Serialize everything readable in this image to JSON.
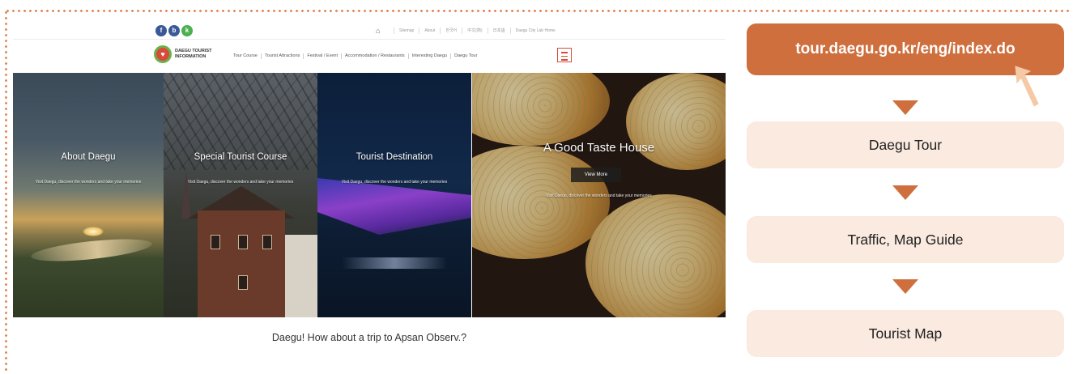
{
  "site": {
    "social": [
      {
        "icon": "facebook-icon",
        "glyph": "f",
        "color": "#3b5998"
      },
      {
        "icon": "blog-icon",
        "glyph": "b",
        "color": "#3b5998"
      },
      {
        "icon": "kakao-icon",
        "glyph": "k",
        "color": "#4caf50"
      }
    ],
    "utility_links": [
      "Sitemap",
      "About",
      "한국어",
      "中文(简)",
      "日本語",
      "Daegu City Lab Home"
    ],
    "logo": {
      "line1": "DAEGU TOURIST",
      "line2": "INFORMATION"
    },
    "menu": [
      "Tour Course",
      "Tourist Attractions",
      "Festival / Event",
      "Accommodation / Restaurants",
      "Interesting Daegu",
      "Daegu Tour"
    ],
    "panels": [
      {
        "title": "About Daegu",
        "sub": "Visit Daegu, discover the wonders and take your memories"
      },
      {
        "title": "Special Tourist Course",
        "sub": "Visit Daegu, discover the wonders and take your memories"
      },
      {
        "title": "Tourist Destination",
        "sub": "Visit Daegu, discover the wonders and take your memories"
      },
      {
        "title": "A Good Taste House",
        "button": "View More",
        "sub": "Visit Daegu, discover the wonders and take your memories"
      }
    ],
    "caption": "Daegu! How about a trip to Apsan Observ.?"
  },
  "flow": {
    "url": "tour.daegu.go.kr/eng/index.do",
    "steps": [
      "Daegu Tour",
      "Traffic, Map Guide",
      "Tourist Map"
    ],
    "accent_color": "#cf6f3e",
    "step_bg": "#faeadf"
  }
}
